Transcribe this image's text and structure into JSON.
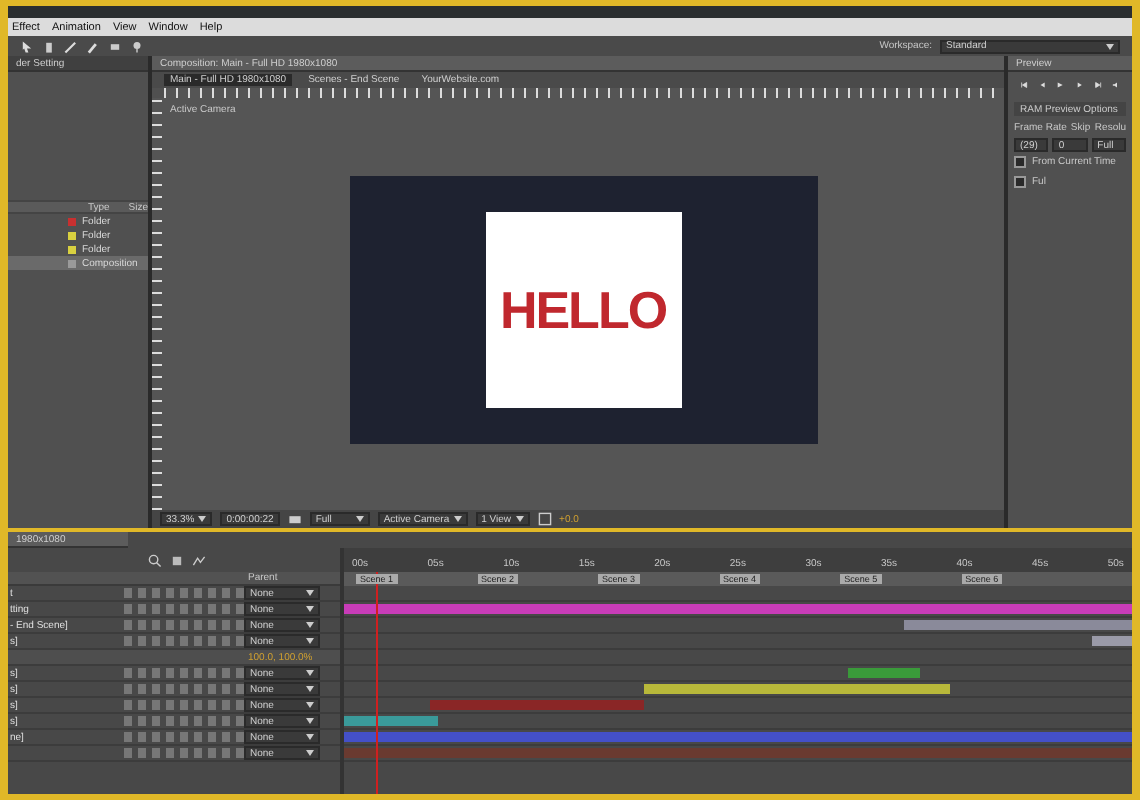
{
  "menu": [
    "Effect",
    "Animation",
    "View",
    "Window",
    "Help"
  ],
  "workspace": {
    "label": "Workspace:",
    "value": "Standard"
  },
  "project_panel": {
    "title": "der Setting",
    "columns": [
      "Type",
      "Size"
    ],
    "items": [
      {
        "type": "Folder",
        "color": "#c83030",
        "selected": false
      },
      {
        "type": "Folder",
        "color": "#d8d040",
        "selected": false
      },
      {
        "type": "Folder",
        "color": "#d8d040",
        "selected": false
      },
      {
        "type": "Composition",
        "color": "#9a9a9a",
        "selected": true
      }
    ]
  },
  "composition_panel": {
    "tab": "Composition: Main - Full HD 1980x1080",
    "breadcrumbs": [
      {
        "label": "Main - Full HD 1980x1080",
        "selected": true
      },
      {
        "label": "Scenes - End Scene",
        "selected": false
      },
      {
        "label": "YourWebsite.com",
        "selected": false
      }
    ],
    "view_label": "Active Camera",
    "canvas_text": "HELLO",
    "footer": {
      "zoom": "33.3%",
      "timecode": "0:00:00:22",
      "resolution": "Full",
      "camera": "Active Camera",
      "views": "1 View",
      "exposure": "+0.0"
    }
  },
  "preview_panel": {
    "tab": "Preview",
    "options_title": "RAM Preview Options",
    "labels": [
      "Frame Rate",
      "Skip",
      "Resolu"
    ],
    "frame_rate": "(29)",
    "skip": "0",
    "resolution": "Full",
    "options": [
      {
        "label": "From Current Time",
        "checked": false
      },
      {
        "label": "Ful",
        "checked": false
      }
    ]
  },
  "timeline": {
    "tab": "1980x1080",
    "parent_header": "Parent",
    "time_labels": [
      "00s",
      "05s",
      "10s",
      "15s",
      "20s",
      "25s",
      "30s",
      "35s",
      "40s",
      "45s",
      "50s"
    ],
    "markers": [
      "Scene 1",
      "Scene 2",
      "Scene 3",
      "Scene 4",
      "Scene 5",
      "Scene 6"
    ],
    "layers": [
      {
        "kind": "layer",
        "name": "t",
        "parent": "None"
      },
      {
        "kind": "layer",
        "name": "tting",
        "parent": "None",
        "color": "#c83cb8"
      },
      {
        "kind": "layer",
        "name": "- End Scene]",
        "parent": "None",
        "color": "#8a8a9a"
      },
      {
        "kind": "layer",
        "name": "s]",
        "parent": "None",
        "color": "#9a9aa8"
      },
      {
        "kind": "property",
        "value": "100.0, 100.0%"
      },
      {
        "kind": "layer",
        "name": "s]",
        "parent": "None",
        "color": "#3a9a3a"
      },
      {
        "kind": "layer",
        "name": "s]",
        "parent": "None",
        "color": "#b8b83a"
      },
      {
        "kind": "layer",
        "name": "s]",
        "parent": "None",
        "color": "#8a2626"
      },
      {
        "kind": "layer",
        "name": "s]",
        "parent": "None",
        "color": "#3a9a9a"
      },
      {
        "kind": "layer",
        "name": "ne]",
        "parent": "None",
        "color": "#4450c8"
      },
      {
        "kind": "layer",
        "parent": "None",
        "color": "#6a3a30"
      }
    ]
  }
}
